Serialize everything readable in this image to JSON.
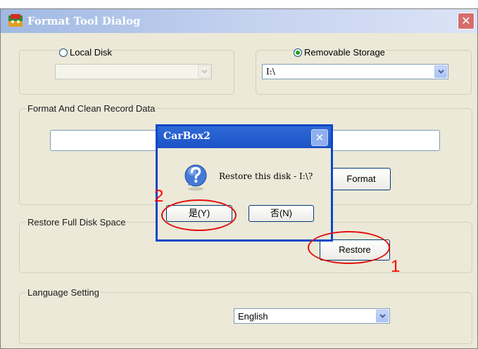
{
  "window": {
    "title": "Format Tool Dialog",
    "close_glyph": "✕"
  },
  "source": {
    "local_disk": {
      "label": "Local Disk",
      "selected": false,
      "combo_value": ""
    },
    "removable": {
      "label": "Removable Storage",
      "selected": true,
      "combo_value": "I:\\"
    }
  },
  "format_group": {
    "label": "Format And Clean Record Data",
    "field_value": "",
    "format_button": "Format"
  },
  "restore_group": {
    "label": "Restore Full Disk Space",
    "restore_button": "Restore"
  },
  "language_group": {
    "label": "Language Setting",
    "value": "English"
  },
  "message_box": {
    "title": "CarBox2",
    "close_glyph": "✕",
    "message": "Restore this disk - I:\\?",
    "icon": "question-icon",
    "yes_button": "是(Y)",
    "no_button": "否(N)"
  },
  "annotations": {
    "step1": "1",
    "step2": "2",
    "color": "#ff0000"
  }
}
